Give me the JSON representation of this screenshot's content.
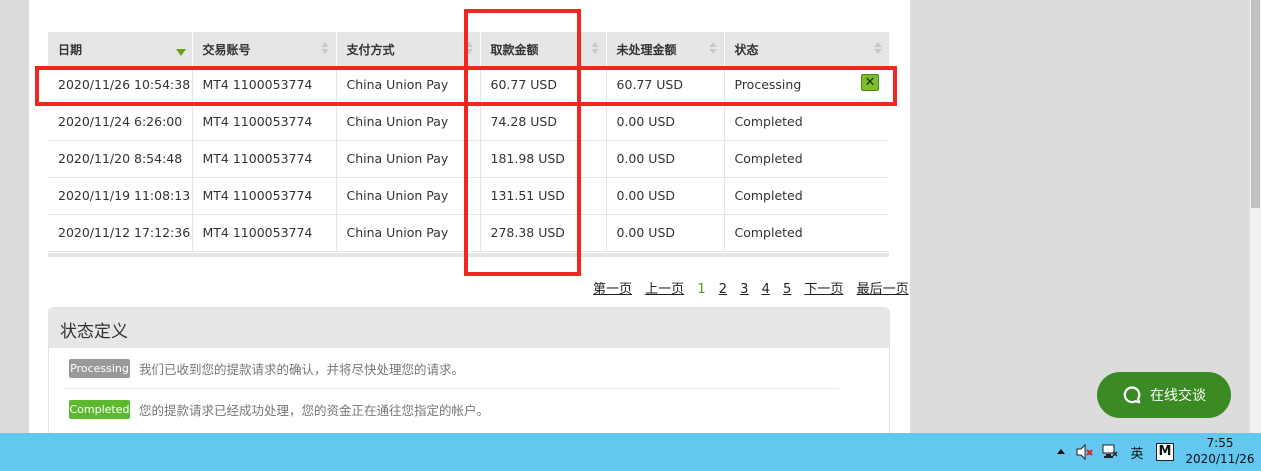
{
  "table": {
    "columns": [
      {
        "label": "日期",
        "sort": "desc"
      },
      {
        "label": "交易账号",
        "sort": "none"
      },
      {
        "label": "支付方式",
        "sort": "none"
      },
      {
        "label": "取款金额",
        "sort": "none"
      },
      {
        "label": "未处理金额",
        "sort": "none"
      },
      {
        "label": "状态",
        "sort": "none"
      }
    ],
    "rows": [
      [
        "2020/11/26 10:54:38",
        "MT4 1100053774",
        "China Union Pay",
        "60.77 USD",
        "60.77 USD",
        "Processing"
      ],
      [
        "2020/11/24 6:26:00",
        "MT4 1100053774",
        "China Union Pay",
        "74.28 USD",
        "0.00 USD",
        "Completed"
      ],
      [
        "2020/11/20 8:54:48",
        "MT4 1100053774",
        "China Union Pay",
        "181.98 USD",
        "0.00 USD",
        "Completed"
      ],
      [
        "2020/11/19 11:08:13",
        "MT4 1100053774",
        "China Union Pay",
        "131.51 USD",
        "0.00 USD",
        "Completed"
      ],
      [
        "2020/11/12 17:12:36",
        "MT4 1100053774",
        "China Union Pay",
        "278.38 USD",
        "0.00 USD",
        "Completed"
      ]
    ],
    "cancel_icon": "✕"
  },
  "pagination": {
    "first": "第一页",
    "prev": "上一页",
    "pages": [
      "1",
      "2",
      "3",
      "4",
      "5"
    ],
    "current": "1",
    "next": "下一页",
    "last": "最后一页"
  },
  "status_def": {
    "title": "状态定义",
    "items": [
      {
        "badge": "Processing",
        "text": "我们已收到您的提款请求的确认，并将尽快处理您的请求。",
        "color": "#999999"
      },
      {
        "badge": "Completed",
        "text": "您的提款请求已经成功处理，您的资金正在通往您指定的帐户。",
        "color": "#5cb82e"
      }
    ]
  },
  "chat": {
    "label": "在线交谈",
    "color": "#3c8a23"
  },
  "taskbar": {
    "ime": "英",
    "ime_mode": "M",
    "time": "7:55",
    "date": "2020/11/26",
    "color": "#63c7ef"
  },
  "annotation_color": "#f1271f"
}
